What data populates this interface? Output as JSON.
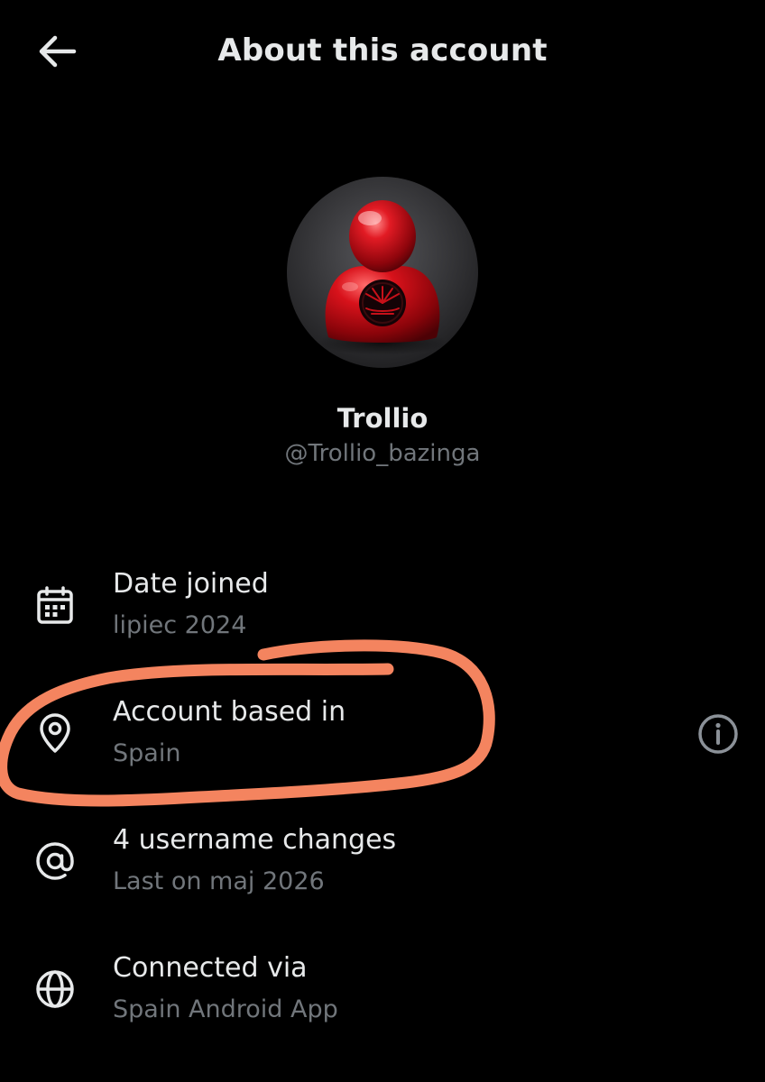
{
  "header": {
    "title": "About this account",
    "back_icon": "arrow-left-icon"
  },
  "profile": {
    "name": "Trollio",
    "handle": "@Trollio_bazinga",
    "avatar_icon": "red-person-avatar"
  },
  "details": [
    {
      "icon": "calendar-icon",
      "title": "Date joined",
      "subtitle": "lipiec 2024"
    },
    {
      "icon": "location-pin-icon",
      "title": "Account based in",
      "subtitle": "Spain",
      "action_icon": "info-icon"
    },
    {
      "icon": "at-sign-icon",
      "title": "4 username changes",
      "subtitle": "Last on maj 2026"
    },
    {
      "icon": "globe-icon",
      "title": "Connected via",
      "subtitle": "Spain Android App"
    }
  ],
  "colors": {
    "background": "#000000",
    "primary_text": "#e7e9ea",
    "secondary_text": "#71767b",
    "annotation": "#f4845f",
    "avatar_red": "#d0121b"
  }
}
